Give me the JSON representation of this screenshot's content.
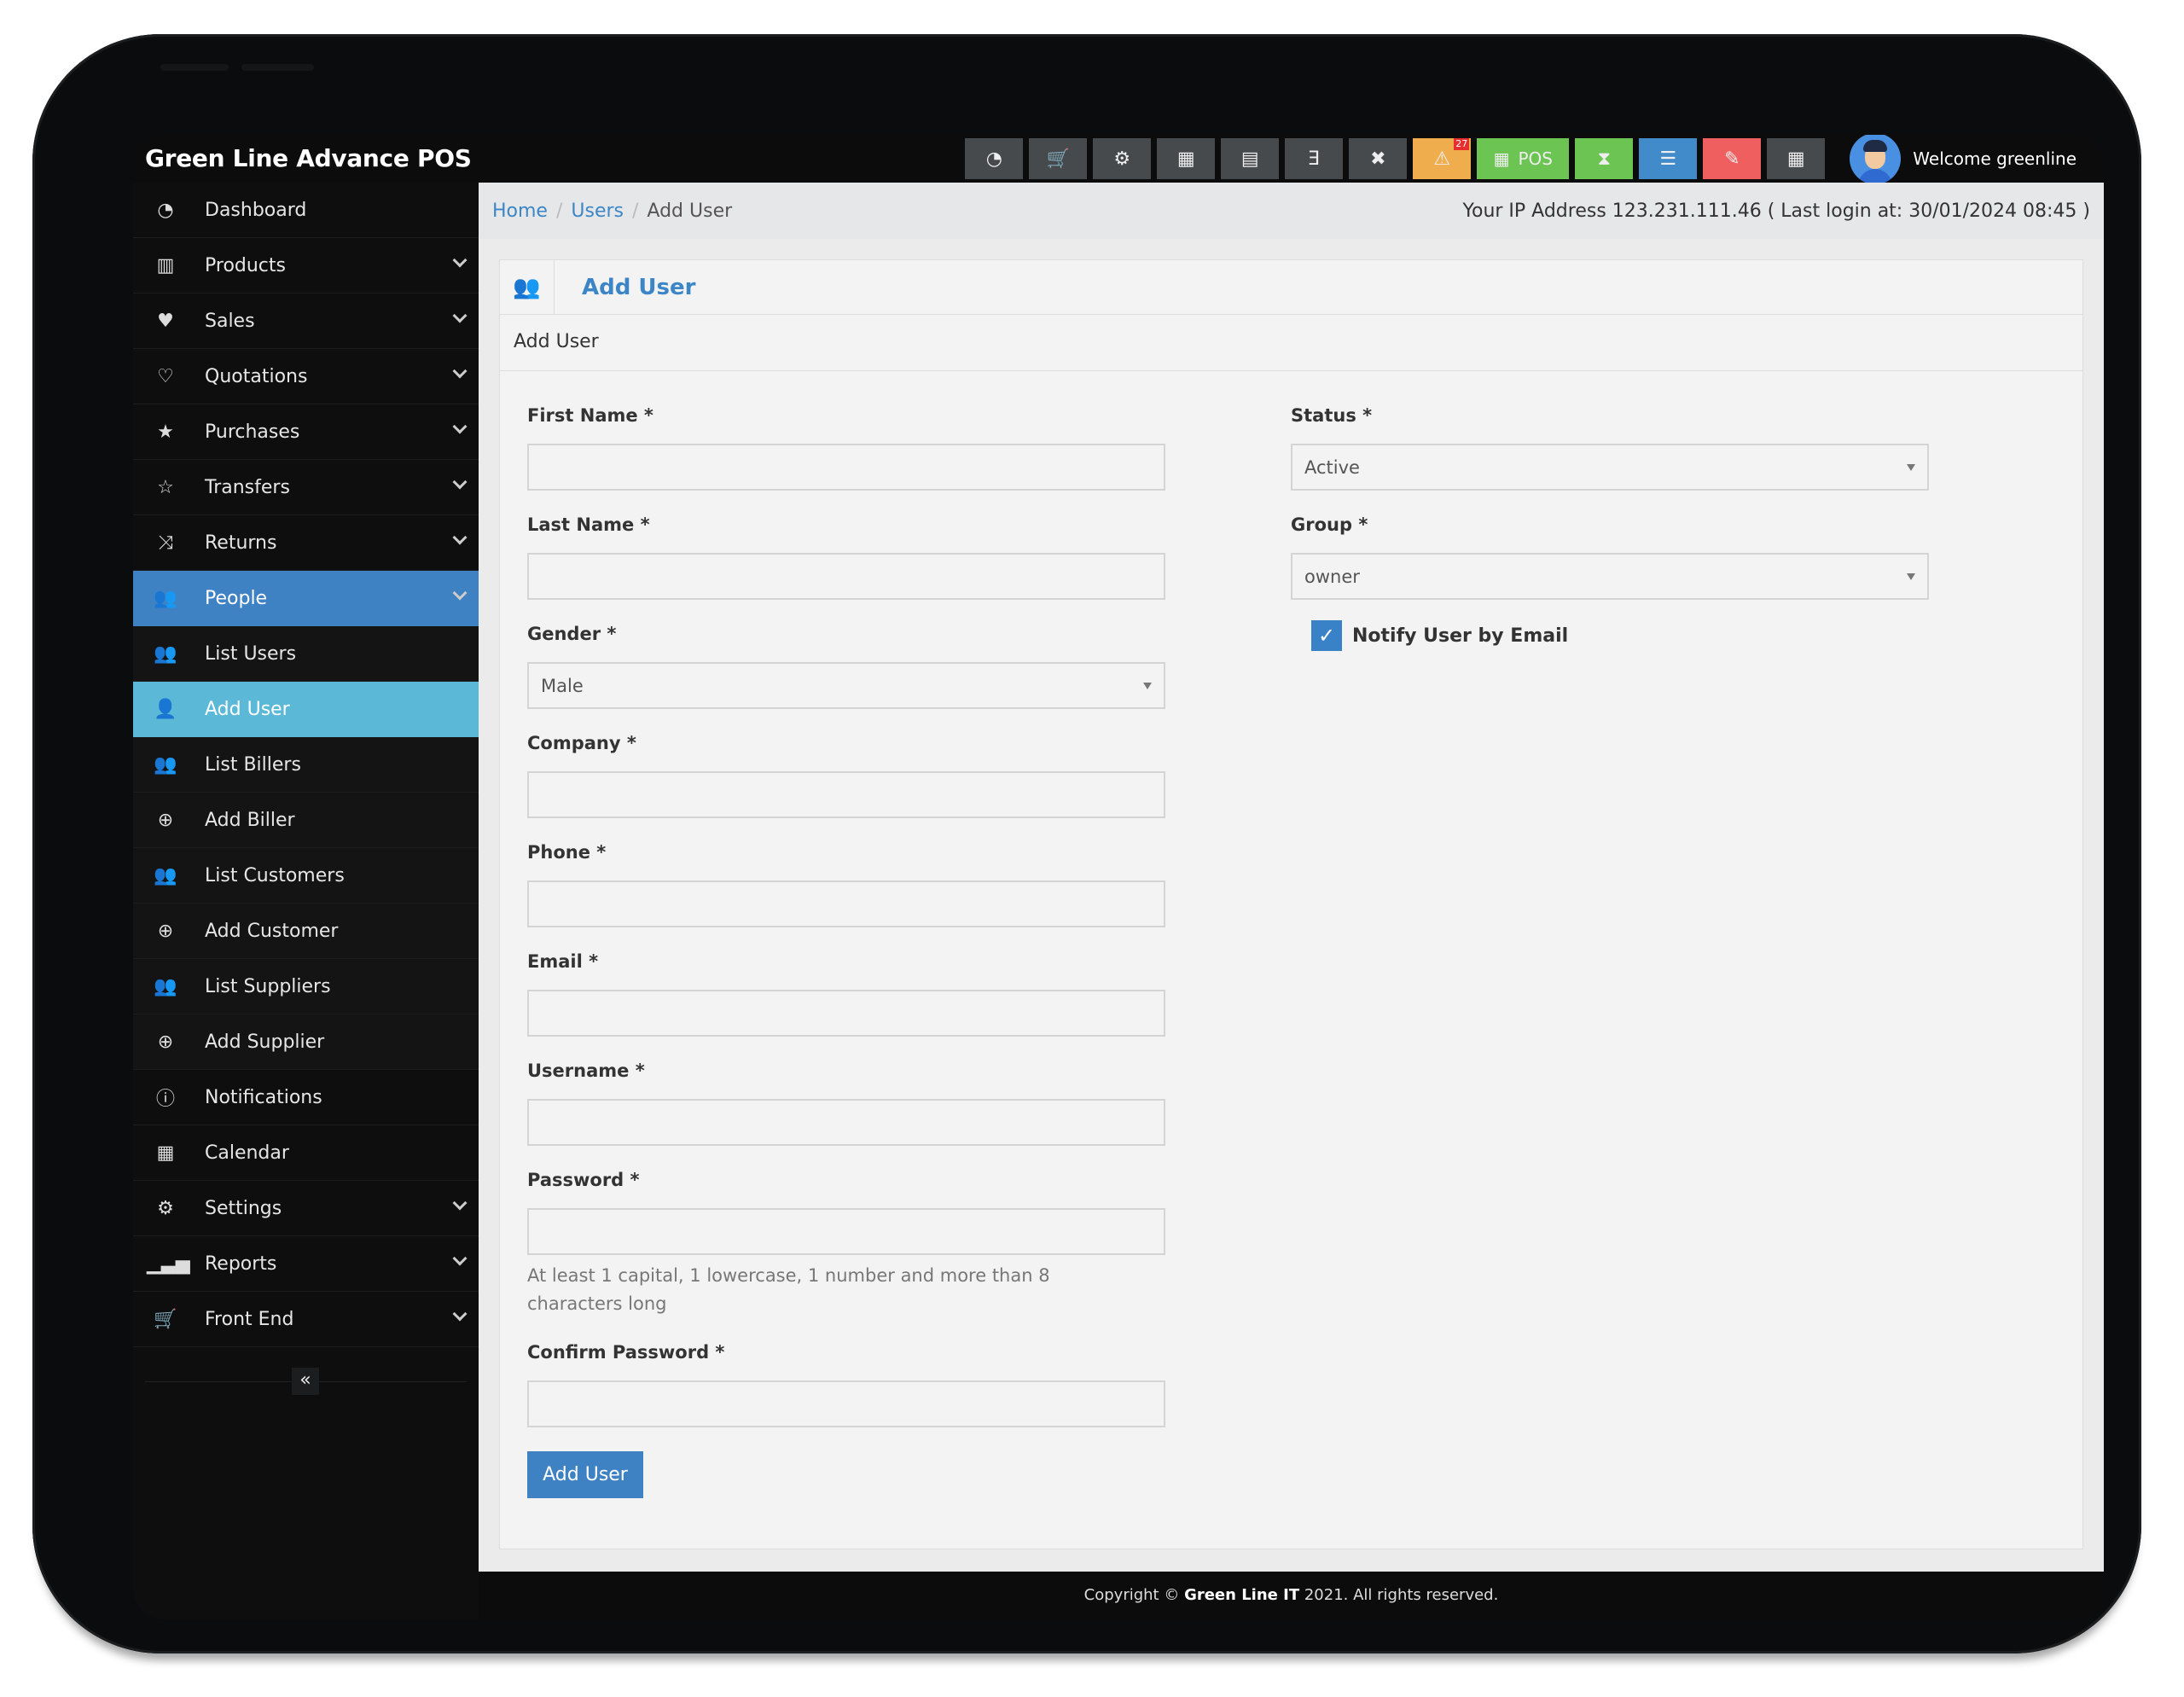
{
  "app": {
    "title": "Green Line Advance POS"
  },
  "topbar": {
    "buttons": [
      {
        "icon": "dashboard-icon",
        "glyph": "◔"
      },
      {
        "icon": "cart-icon",
        "glyph": "🛒"
      },
      {
        "icon": "cogs-icon",
        "glyph": "⚙"
      },
      {
        "icon": "calculator-icon",
        "glyph": "▦"
      },
      {
        "icon": "calendar-icon",
        "glyph": "▤"
      },
      {
        "icon": "css3-icon",
        "glyph": "Ǝ"
      },
      {
        "icon": "uk-flag-icon",
        "glyph": "✖"
      },
      {
        "icon": "alert-icon",
        "glyph": "⚠",
        "badge": "27"
      },
      {
        "icon": "pos-grid-icon",
        "glyph": "▦",
        "label": "POS"
      },
      {
        "icon": "hourglass-icon",
        "glyph": "⧗"
      },
      {
        "icon": "list-icon",
        "glyph": "☰"
      },
      {
        "icon": "eraser-icon",
        "glyph": "✎"
      },
      {
        "icon": "grid-icon",
        "glyph": "▦"
      }
    ],
    "welcome": "Welcome greenline"
  },
  "sidebar": {
    "items": [
      {
        "label": "Dashboard",
        "icon": "dashboard-icon",
        "glyph": "◔",
        "chevron": false
      },
      {
        "label": "Products",
        "icon": "barcode-icon",
        "glyph": "▥",
        "chevron": true
      },
      {
        "label": "Sales",
        "icon": "heart-icon",
        "glyph": "♥",
        "chevron": true
      },
      {
        "label": "Quotations",
        "icon": "heart-outline-icon",
        "glyph": "♡",
        "chevron": true
      },
      {
        "label": "Purchases",
        "icon": "star-icon",
        "glyph": "★",
        "chevron": true
      },
      {
        "label": "Transfers",
        "icon": "star-outline-icon",
        "glyph": "☆",
        "chevron": true
      },
      {
        "label": "Returns",
        "icon": "random-icon",
        "glyph": "⤨",
        "chevron": true
      },
      {
        "label": "People",
        "icon": "users-icon",
        "glyph": "👥",
        "chevron": true,
        "state": "active-parent"
      },
      {
        "label": "List Users",
        "icon": "users-icon",
        "glyph": "👥",
        "state": "sub"
      },
      {
        "label": "Add User",
        "icon": "user-plus-icon",
        "glyph": "👤",
        "state": "active"
      },
      {
        "label": "List Billers",
        "icon": "users-icon",
        "glyph": "👥",
        "state": "sub"
      },
      {
        "label": "Add Biller",
        "icon": "plus-circle-icon",
        "glyph": "⊕",
        "state": "sub"
      },
      {
        "label": "List Customers",
        "icon": "users-icon",
        "glyph": "👥",
        "state": "sub"
      },
      {
        "label": "Add Customer",
        "icon": "plus-circle-icon",
        "glyph": "⊕",
        "state": "sub"
      },
      {
        "label": "List Suppliers",
        "icon": "users-icon",
        "glyph": "👥",
        "state": "sub"
      },
      {
        "label": "Add Supplier",
        "icon": "plus-circle-icon",
        "glyph": "⊕",
        "state": "sub"
      },
      {
        "label": "Notifications",
        "icon": "info-icon",
        "glyph": "ⓘ",
        "chevron": false
      },
      {
        "label": "Calendar",
        "icon": "calendar-icon",
        "glyph": "▦",
        "chevron": false
      },
      {
        "label": "Settings",
        "icon": "cog-icon",
        "glyph": "⚙",
        "chevron": true
      },
      {
        "label": "Reports",
        "icon": "bar-chart-icon",
        "glyph": "▁▃▅",
        "chevron": true
      },
      {
        "label": "Front End",
        "icon": "cart-icon",
        "glyph": "🛒",
        "chevron": true
      }
    ],
    "collapse_glyph": "«"
  },
  "breadcrumb": {
    "home": "Home",
    "users": "Users",
    "current": "Add User",
    "sep": "/"
  },
  "session": {
    "ip_text": "Your IP Address 123.231.111.46 ( Last login at: 30/01/2024 08:45 )"
  },
  "box": {
    "title": "Add User",
    "intro": "Add User",
    "icon_glyph": "👥"
  },
  "form": {
    "first_name": {
      "label": "First Name *",
      "value": ""
    },
    "last_name": {
      "label": "Last Name *",
      "value": ""
    },
    "gender": {
      "label": "Gender *",
      "value": "Male"
    },
    "company": {
      "label": "Company *",
      "value": ""
    },
    "phone": {
      "label": "Phone *",
      "value": ""
    },
    "email": {
      "label": "Email *",
      "value": ""
    },
    "username": {
      "label": "Username *",
      "value": ""
    },
    "password": {
      "label": "Password *",
      "value": "",
      "help": "At least 1 capital, 1 lowercase, 1 number and more than 8 characters long"
    },
    "confirm_password": {
      "label": "Confirm Password *",
      "value": ""
    },
    "status": {
      "label": "Status *",
      "value": "Active"
    },
    "group": {
      "label": "Group *",
      "value": "owner"
    },
    "notify": {
      "label": "Notify User by Email",
      "checked": true,
      "check_glyph": "✓"
    },
    "submit_label": "Add User"
  },
  "footer": {
    "prefix": "Copyright © ",
    "company": "Green Line IT",
    "suffix": " 2021. All rights reserved."
  }
}
